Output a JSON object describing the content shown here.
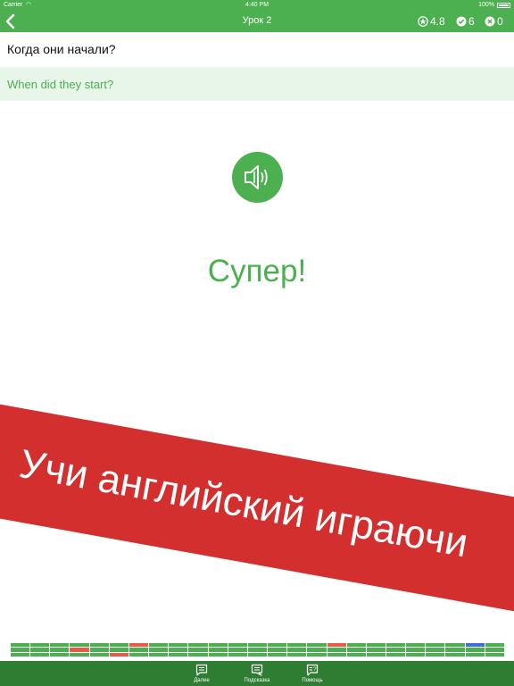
{
  "status_bar": {
    "carrier": "Carrier",
    "time": "4:40 PM",
    "battery": "100%"
  },
  "nav": {
    "title": "Урок 2",
    "rating": "4.8",
    "correct": "6",
    "wrong": "0"
  },
  "question": "Когда они начали?",
  "answer": "When did they start?",
  "feedback": "Супер!",
  "banner": "Учи английский играючи",
  "progress": {
    "columns": 25,
    "rows": 3,
    "marks": [
      {
        "col": 3,
        "row": 1,
        "color": "red"
      },
      {
        "col": 5,
        "row": 2,
        "color": "red"
      },
      {
        "col": 6,
        "row": 0,
        "color": "red"
      },
      {
        "col": 16,
        "row": 0,
        "color": "red"
      },
      {
        "col": 23,
        "row": 0,
        "color": "blue"
      }
    ]
  },
  "tabs": [
    {
      "label": "Далее",
      "icon": "chat-next-icon"
    },
    {
      "label": "Подсказка",
      "icon": "chat-hint-icon"
    },
    {
      "label": "Помощь",
      "icon": "help-icon"
    }
  ],
  "colors": {
    "primary": "#4caf50",
    "tabbar": "#2e7d32",
    "banner": "#d32f2f",
    "answer_bg": "#e8f5e9"
  }
}
